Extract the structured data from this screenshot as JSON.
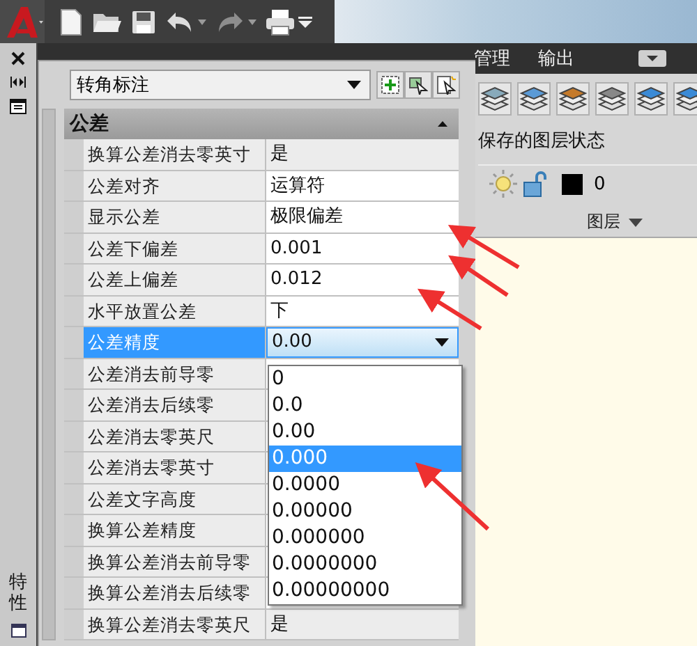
{
  "ribbon_tabs": [
    {
      "label": "管理",
      "selected": false
    },
    {
      "label": "输出",
      "selected": false
    }
  ],
  "layer_panel": {
    "state_label": "保存的图层状态",
    "layer_name": "0",
    "panel_title": "图层"
  },
  "side_strip": {
    "title": "特性"
  },
  "palette": {
    "object_type": "转角标注",
    "section": {
      "title": "公差",
      "expanded": true
    },
    "rows": [
      {
        "label": "换算公差消去零英寸",
        "value": "是",
        "readonly": true,
        "selected": false
      },
      {
        "label": "公差对齐",
        "value": "运算符",
        "readonly": false,
        "selected": false
      },
      {
        "label": "显示公差",
        "value": "极限偏差",
        "readonly": false,
        "selected": false
      },
      {
        "label": "公差下偏差",
        "value": "0.001",
        "readonly": false,
        "selected": false
      },
      {
        "label": "公差上偏差",
        "value": "0.012",
        "readonly": false,
        "selected": false
      },
      {
        "label": "水平放置公差",
        "value": "下",
        "readonly": false,
        "selected": false
      },
      {
        "label": "公差精度",
        "value": "0.00",
        "readonly": false,
        "selected": true
      },
      {
        "label": "公差消去前导零",
        "readonly": false,
        "selected": false
      },
      {
        "label": "公差消去后续零",
        "readonly": false,
        "selected": false
      },
      {
        "label": "公差消去零英尺",
        "readonly": false,
        "selected": false
      },
      {
        "label": "公差消去零英寸",
        "readonly": false,
        "selected": false
      },
      {
        "label": "公差文字高度",
        "readonly": false,
        "selected": false
      },
      {
        "label": "换算公差精度",
        "readonly": false,
        "selected": false
      },
      {
        "label": "换算公差消去前导零",
        "readonly": false,
        "selected": false
      },
      {
        "label": "换算公差消去后续零",
        "readonly": false,
        "selected": false
      },
      {
        "label": "换算公差消去零英尺",
        "value": "是",
        "readonly": true,
        "selected": false
      }
    ],
    "dropdown_options": [
      {
        "label": "0",
        "selected": false
      },
      {
        "label": "0.0",
        "selected": false
      },
      {
        "label": "0.00",
        "selected": false
      },
      {
        "label": "0.000",
        "selected": true
      },
      {
        "label": "0.0000",
        "selected": false
      },
      {
        "label": "0.00000",
        "selected": false
      },
      {
        "label": "0.000000",
        "selected": false
      },
      {
        "label": "0.0000000",
        "selected": false
      },
      {
        "label": "0.00000000",
        "selected": false
      }
    ]
  }
}
